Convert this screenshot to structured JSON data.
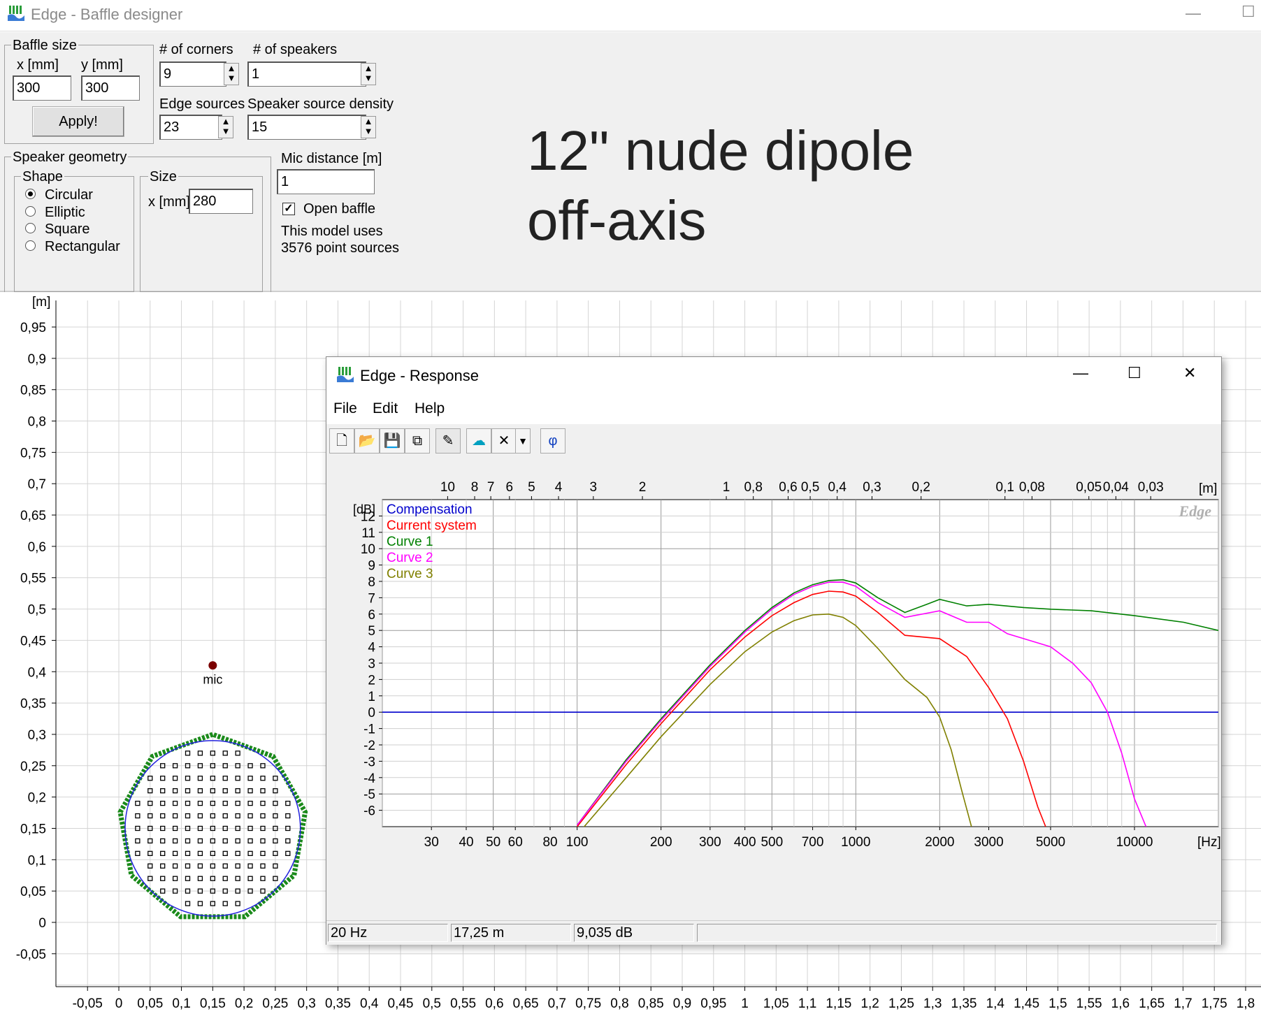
{
  "main_window": {
    "title": "Edge - Baffle designer",
    "minimize": "—",
    "maximize": "☐"
  },
  "baffle_size": {
    "group_label": "Baffle size",
    "x_label": "x [mm]",
    "y_label": "y [mm]",
    "x_value": "300",
    "y_value": "300",
    "apply_label": "Apply!"
  },
  "corners": {
    "label": "# of corners",
    "value": "9"
  },
  "speakers": {
    "label": "# of speakers",
    "value": "1"
  },
  "edge_sources": {
    "label": "Edge sources",
    "value": "23"
  },
  "speaker_density": {
    "label": "Speaker source density",
    "value": "15"
  },
  "speaker_geometry": {
    "group_label": "Speaker geometry",
    "shape_label": "Shape",
    "shapes": [
      "Circular",
      "Elliptic",
      "Square",
      "Rectangular"
    ],
    "selected": "Circular",
    "size_label": "Size",
    "size_x_label": "x [mm]",
    "size_x_value": "280"
  },
  "mic_distance": {
    "label": "Mic distance [m]",
    "value": "1"
  },
  "open_baffle": {
    "label": "Open baffle",
    "checked": true
  },
  "model_info": {
    "line1": "This model uses",
    "line2": "3576 point sources"
  },
  "annotation": {
    "line1": "12\" nude dipole",
    "line2": "off-axis"
  },
  "baffle_plot": {
    "y_unit": "[m]",
    "y_ticks": [
      "0,95",
      "0,9",
      "0,85",
      "0,8",
      "0,75",
      "0,7",
      "0,65",
      "0,6",
      "0,55",
      "0,5",
      "0,45",
      "0,4",
      "0,35",
      "0,3",
      "0,25",
      "0,2",
      "0,15",
      "0,1",
      "0,05",
      "0",
      "-0,05"
    ],
    "x_ticks": [
      "-0,05",
      "0",
      "0,05",
      "0,1",
      "0,15",
      "0,2",
      "0,25",
      "0,3",
      "0,35",
      "0,4",
      "0,45",
      "0,5",
      "0,55",
      "0,6",
      "0,65",
      "0,7",
      "0,75",
      "0,8",
      "0,85",
      "0,9",
      "0,95",
      "1",
      "1,05",
      "1,1",
      "1,15",
      "1,2",
      "1,25",
      "1,3",
      "1,35",
      "1,4",
      "1,45",
      "1,5",
      "1,55",
      "1,6",
      "1,65",
      "1,7",
      "1,75",
      "1,8"
    ],
    "mic_label": "mic",
    "mic_position": [
      0.15,
      0.41
    ],
    "baffle_corners": 9,
    "baffle_size_m": [
      0.3,
      0.3
    ],
    "speaker_diameter_m": 0.28
  },
  "response_window": {
    "title": "Edge - Response",
    "minimize": "—",
    "maximize": "☐",
    "close": "✕",
    "menu": [
      "File",
      "Edit",
      "Help"
    ],
    "watermark": "Edge",
    "status": {
      "frequency": "20 Hz",
      "distance": "17,25 m",
      "level": "9,035 dB"
    }
  },
  "chart_data": {
    "type": "line",
    "xlabel": "[Hz]",
    "ylabel": "[dB]",
    "top_axis_label": "[m]",
    "x_scale": "log",
    "xlim": [
      20,
      20000
    ],
    "ylim": [
      -7,
      13
    ],
    "x_tick_labels": [
      "30",
      "40",
      "50",
      "60",
      "80",
      "100",
      "200",
      "300",
      "400",
      "500",
      "700",
      "1000",
      "2000",
      "3000",
      "5000",
      "10000"
    ],
    "x_tick_values": [
      30,
      40,
      50,
      60,
      80,
      100,
      200,
      300,
      400,
      500,
      700,
      1000,
      2000,
      3000,
      5000,
      10000
    ],
    "y_tick_labels": [
      "12",
      "11",
      "10",
      "9",
      "8",
      "7",
      "6",
      "5",
      "4",
      "3",
      "2",
      "1",
      "0",
      "-1",
      "-2",
      "-3",
      "-4",
      "-5",
      "-6"
    ],
    "top_tick_labels": [
      "10",
      "8",
      "7",
      "6",
      "5",
      "4",
      "3",
      "2",
      "1",
      "0,8",
      "0,6",
      "0,5",
      "0,4",
      "0,3",
      "0,2",
      "0,1",
      "0,08",
      "0,05",
      "0,04",
      "0,03"
    ],
    "top_tick_values": [
      10,
      8,
      7,
      6,
      5,
      4,
      3,
      2,
      1,
      0.8,
      0.6,
      0.5,
      0.4,
      0.3,
      0.2,
      0.1,
      0.08,
      0.05,
      0.04,
      0.03
    ],
    "legend_position": "top-left",
    "grid": true,
    "series": [
      {
        "name": "Compensation",
        "color": "#0000cc",
        "x": [
          20,
          20000
        ],
        "y": [
          0,
          0
        ]
      },
      {
        "name": "Current system",
        "color": "#ff0000",
        "x": [
          100,
          150,
          200,
          300,
          400,
          500,
          600,
          700,
          800,
          900,
          1000,
          1200,
          1500,
          2000,
          2500,
          3000,
          3500,
          4000,
          4500,
          4800
        ],
        "y": [
          -7,
          -3.2,
          -0.7,
          2.6,
          4.6,
          5.9,
          6.7,
          7.2,
          7.4,
          7.35,
          7.1,
          6.1,
          4.7,
          4.5,
          3.4,
          1.5,
          -0.4,
          -3,
          -5.8,
          -7
        ]
      },
      {
        "name": "Curve 1",
        "color": "#008000",
        "x": [
          100,
          150,
          200,
          300,
          400,
          500,
          600,
          700,
          800,
          900,
          1000,
          1200,
          1500,
          1800,
          2000,
          2500,
          3000,
          4000,
          5000,
          7000,
          10000,
          15000,
          20000
        ],
        "y": [
          -6.9,
          -2.9,
          -0.4,
          2.9,
          5,
          6.4,
          7.3,
          7.8,
          8.05,
          8.1,
          7.9,
          7,
          6.1,
          6.6,
          6.9,
          6.5,
          6.6,
          6.4,
          6.3,
          6.2,
          5.9,
          5.5,
          5.0
        ]
      },
      {
        "name": "Curve 2",
        "color": "#ff00ff",
        "x": [
          100,
          150,
          200,
          300,
          400,
          500,
          600,
          700,
          800,
          900,
          1000,
          1200,
          1500,
          2000,
          2500,
          3000,
          3500,
          4000,
          5000,
          6000,
          7000,
          8000,
          9000,
          10000,
          11000
        ],
        "y": [
          -6.9,
          -3,
          -0.5,
          2.8,
          4.9,
          6.3,
          7.2,
          7.7,
          7.95,
          7.95,
          7.7,
          6.7,
          5.8,
          6.2,
          5.5,
          5.5,
          4.8,
          4.5,
          4.0,
          3.0,
          1.8,
          0,
          -2.5,
          -5.3,
          -7
        ]
      },
      {
        "name": "Curve 3",
        "color": "#808000",
        "x": [
          100,
          150,
          200,
          300,
          400,
          500,
          600,
          700,
          800,
          900,
          1000,
          1200,
          1500,
          1800,
          2000,
          2200,
          2400,
          2600
        ],
        "y": [
          -7.5,
          -4,
          -1.5,
          1.7,
          3.7,
          4.9,
          5.6,
          5.95,
          6,
          5.8,
          5.3,
          3.9,
          2.0,
          0.9,
          -0.3,
          -2.3,
          -4.8,
          -7
        ]
      }
    ]
  }
}
